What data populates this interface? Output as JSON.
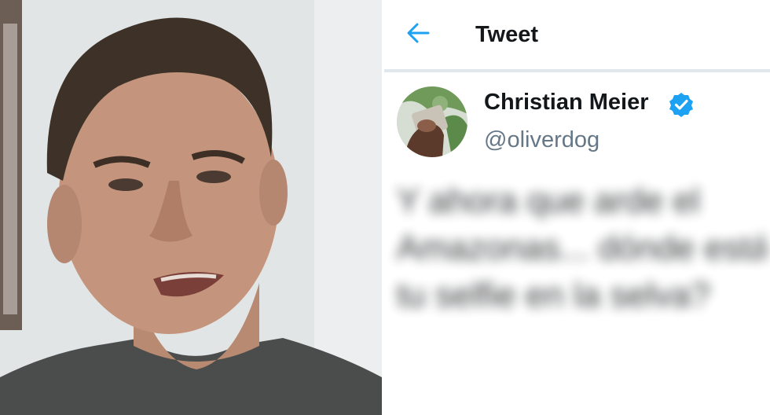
{
  "header": {
    "back_icon": "arrow-left-icon",
    "title": "Tweet"
  },
  "author": {
    "name": "Christian Meier",
    "handle": "@oliverdog",
    "verified_icon": "verified-badge-icon",
    "avatar_icon": "profile-avatar"
  },
  "tweet": {
    "lines": [
      "Y ahora que arde el",
      "Amazonas... dónde está",
      "tu selfie en la selva?"
    ]
  },
  "colors": {
    "accent": "#1da1f2",
    "text_primary": "#14171a",
    "text_secondary": "#657786",
    "divider": "#e1e8ed"
  }
}
